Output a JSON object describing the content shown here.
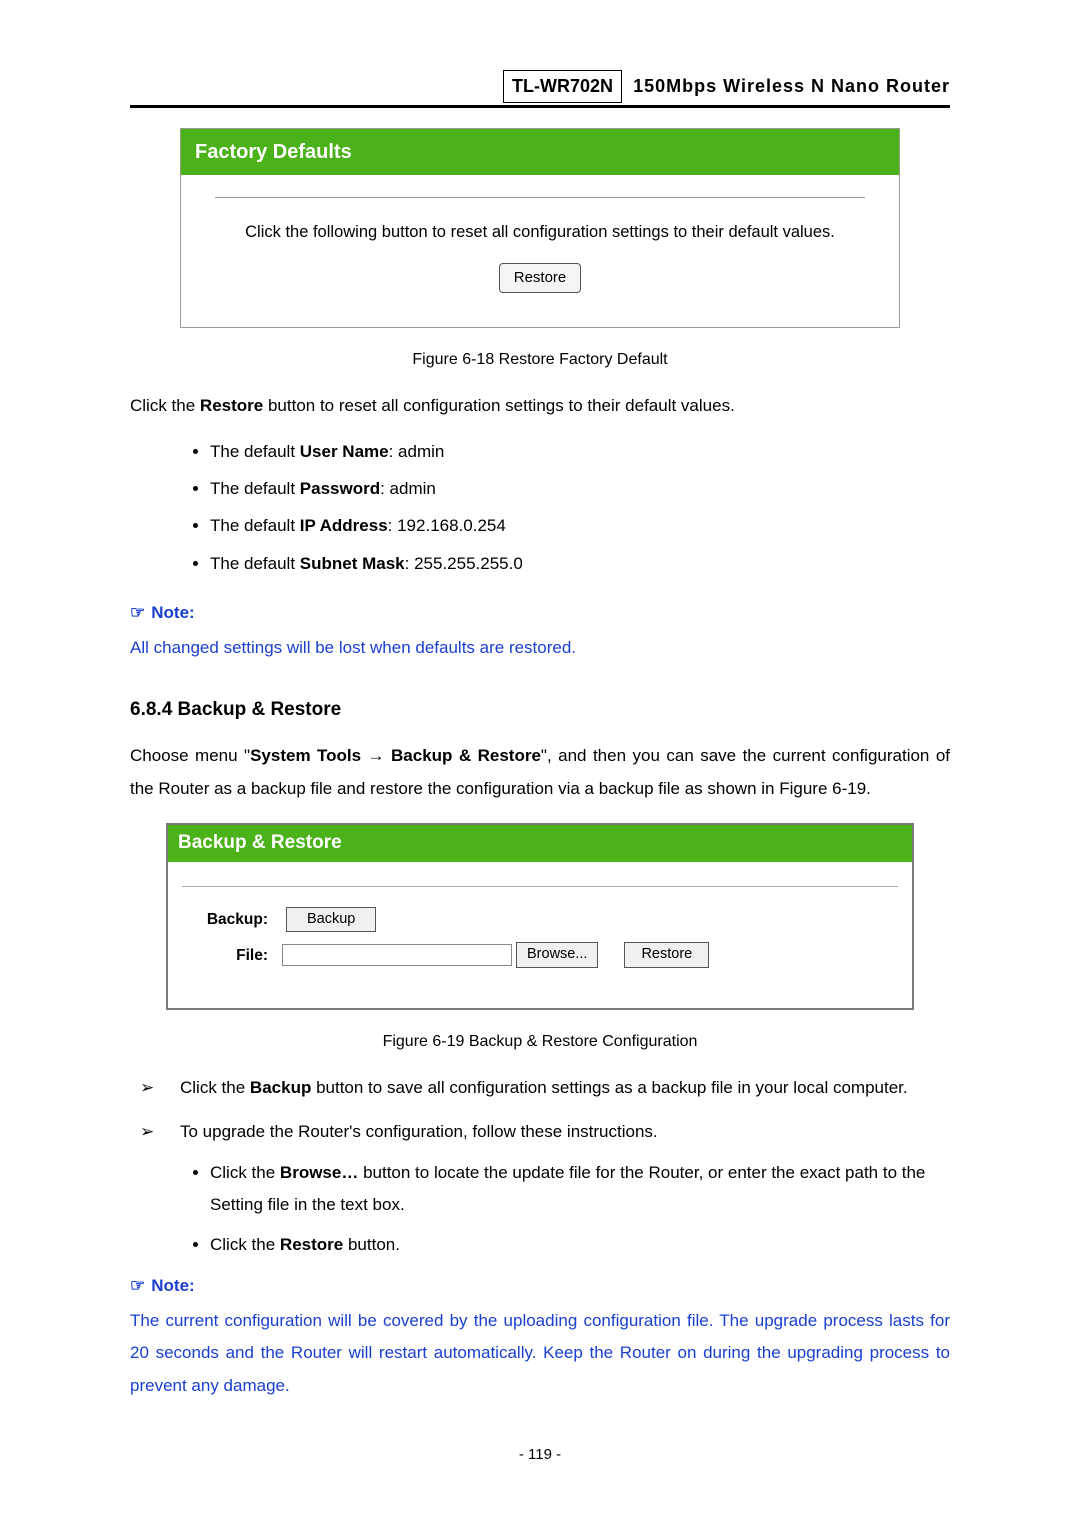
{
  "header": {
    "model": "TL-WR702N",
    "desc": "150Mbps  Wireless  N  Nano  Router"
  },
  "factoryPanel": {
    "title": "Factory Defaults",
    "text": "Click the following button to reset all configuration settings to their default values.",
    "restoreBtn": "Restore"
  },
  "figure618": "Figure 6-18 Restore Factory Default",
  "restorePara": {
    "pre": "Click the ",
    "bold": "Restore",
    "post": " button to reset all configuration settings to their default values."
  },
  "defaults": [
    {
      "pre": "The default ",
      "bold": "User Name",
      "post": ": admin"
    },
    {
      "pre": "The default ",
      "bold": "Password",
      "post": ": admin"
    },
    {
      "pre": "The default ",
      "bold": "IP Address",
      "post": ": 192.168.0.254"
    },
    {
      "pre": "The default ",
      "bold": "Subnet Mask",
      "post": ": 255.255.255.0"
    }
  ],
  "note1": {
    "icon": "☞",
    "label": "Note:",
    "body": "All changed settings will be lost when defaults are restored."
  },
  "section": "6.8.4  Backup & Restore",
  "sectionPara": {
    "p1a": "Choose menu \"",
    "b1": "System Tools",
    "arrow": " → ",
    "b2": "Backup & Restore",
    "p1b": "\", and then you can save the current configuration of the Router as a backup file and restore the configuration via a backup file as shown in Figure 6-19."
  },
  "backupPanel": {
    "title": "Backup & Restore",
    "labelBackup": "Backup:",
    "labelFile": "File:",
    "backupBtn": "Backup",
    "browseBtn": "Browse...",
    "restoreBtn": "Restore"
  },
  "figure619": "Figure 6-19    Backup & Restore Configuration",
  "arrowItem1": {
    "pre": "Click the ",
    "bold": "Backup",
    "post": " button to save all configuration settings as a backup file in your local computer."
  },
  "arrowItem2": "To upgrade the Router's configuration, follow these instructions.",
  "innerB1": {
    "pre": "Click the ",
    "bold": "Browse…",
    "post": " button to locate the update file for the Router, or enter the exact path to the Setting file in the text box."
  },
  "innerB2": {
    "pre": "Click the ",
    "bold": "Restore",
    "post": " button."
  },
  "note2": {
    "icon": "☞",
    "label": "Note:",
    "body": "The current configuration will be covered by the uploading configuration file. The upgrade process lasts for 20 seconds and the Router will restart automatically. Keep the Router on during the upgrading process to prevent any damage."
  },
  "pageNumber": "- 119 -"
}
